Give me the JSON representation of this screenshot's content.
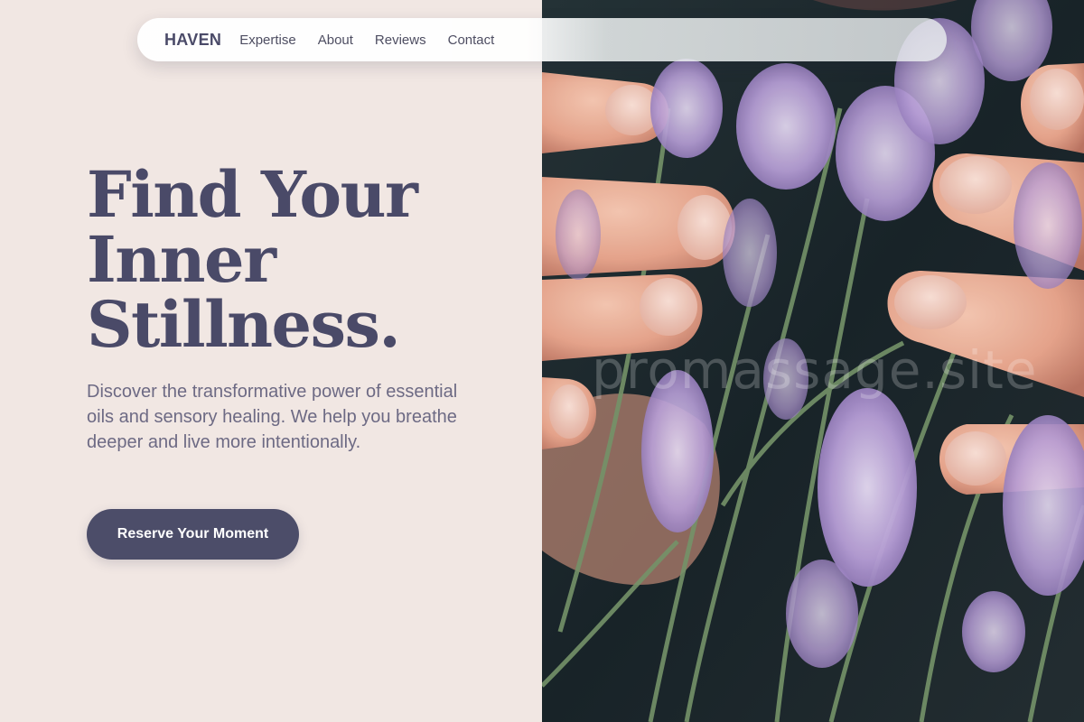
{
  "nav": {
    "brand": "HAVEN",
    "links": [
      "Expertise",
      "About",
      "Reviews",
      "Contact"
    ]
  },
  "hero": {
    "title_lines": [
      "Find Your",
      "Inner",
      "Stillness."
    ],
    "subtitle": "Discover the transformative power of essential oils and sensory healing. We help you breathe deeper and live more intentionally.",
    "cta_label": "Reserve Your Moment"
  },
  "image": {
    "description_icon": "lavender-hands-photo",
    "watermark": "promassage.site"
  },
  "colors": {
    "background": "#f1e7e3",
    "primary_text": "#4a4a68",
    "body_text": "#6d6a84",
    "button": "#4c4d69",
    "button_text": "#ffffff"
  }
}
